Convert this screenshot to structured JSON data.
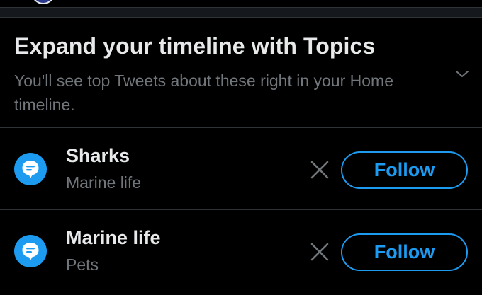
{
  "topics_card": {
    "title": "Expand your timeline with Topics",
    "subtitle": "You'll see top Tweets about these right in your Home timeline.",
    "collapse_icon": "chevron-down-icon"
  },
  "topics": [
    {
      "name": "Sharks",
      "category": "Marine life",
      "icon": "topic-bubble-icon",
      "dismiss_icon": "close-icon",
      "follow_label": "Follow"
    },
    {
      "name": "Marine life",
      "category": "Pets",
      "icon": "topic-bubble-icon",
      "dismiss_icon": "close-icon",
      "follow_label": "Follow"
    }
  ],
  "colors": {
    "background": "#000000",
    "accent": "#1d9bf0",
    "primary_text": "#e7e9ea",
    "secondary_text": "#71767b",
    "divider": "#2f3336"
  }
}
